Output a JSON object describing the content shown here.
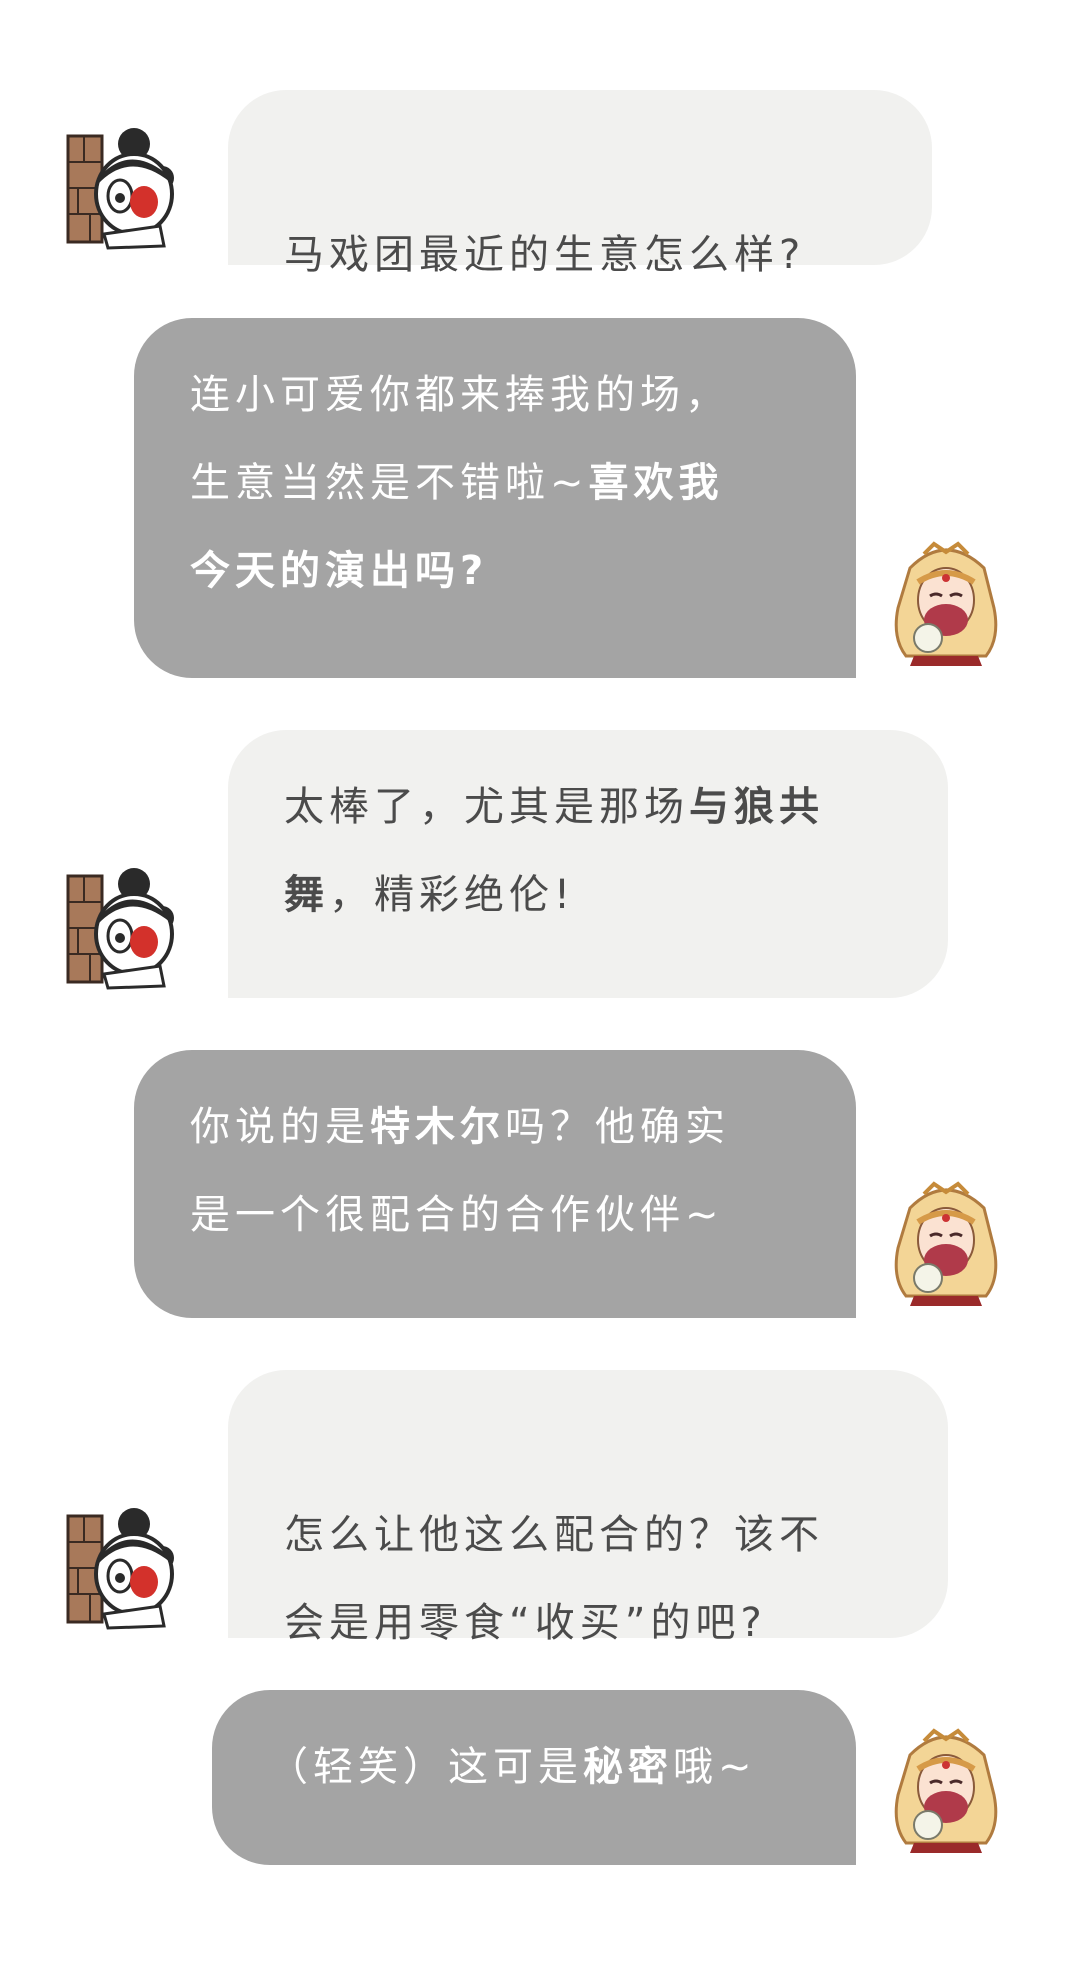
{
  "colors": {
    "background": "#ffffff",
    "user_bubble": "#f1f1ef",
    "user_text": "#4b4b4b",
    "reply_bubble": "#a4a4a4",
    "reply_text": "#ffffff"
  },
  "messages": [
    {
      "sender": "user",
      "avatar_icon": "girl-peeking-avatar-icon",
      "segments": [
        {
          "text": "马戏团最近的生意怎么样?",
          "bold": false
        }
      ]
    },
    {
      "sender": "reply",
      "avatar_icon": "blonde-woman-avatar-icon",
      "segments": [
        {
          "text": "连小可爱你都来捧我的场，\n生意当然是不错啦~",
          "bold": false
        },
        {
          "text": "喜欢我\n今天的演出吗?",
          "bold": true
        }
      ]
    },
    {
      "sender": "user",
      "avatar_icon": "girl-peeking-avatar-icon",
      "segments": [
        {
          "text": "太棒了，尤其是那场",
          "bold": false
        },
        {
          "text": "与狼共\n舞",
          "bold": true
        },
        {
          "text": "，精彩绝伦!",
          "bold": false
        }
      ]
    },
    {
      "sender": "reply",
      "avatar_icon": "blonde-woman-avatar-icon",
      "segments": [
        {
          "text": "你说的是",
          "bold": false
        },
        {
          "text": "特木尔",
          "bold": true
        },
        {
          "text": "吗？他确实\n是一个很配合的合作伙伴~",
          "bold": false
        }
      ]
    },
    {
      "sender": "user",
      "avatar_icon": "girl-peeking-avatar-icon",
      "segments": [
        {
          "text": "怎么让他这么配合的？该不\n会是用零食“收买”的吧?",
          "bold": false
        }
      ]
    },
    {
      "sender": "reply",
      "avatar_icon": "blonde-woman-avatar-icon",
      "segments": [
        {
          "text": "（轻笑）这可是",
          "bold": false
        },
        {
          "text": "秘密",
          "bold": true
        },
        {
          "text": "哦~",
          "bold": false
        }
      ]
    }
  ]
}
